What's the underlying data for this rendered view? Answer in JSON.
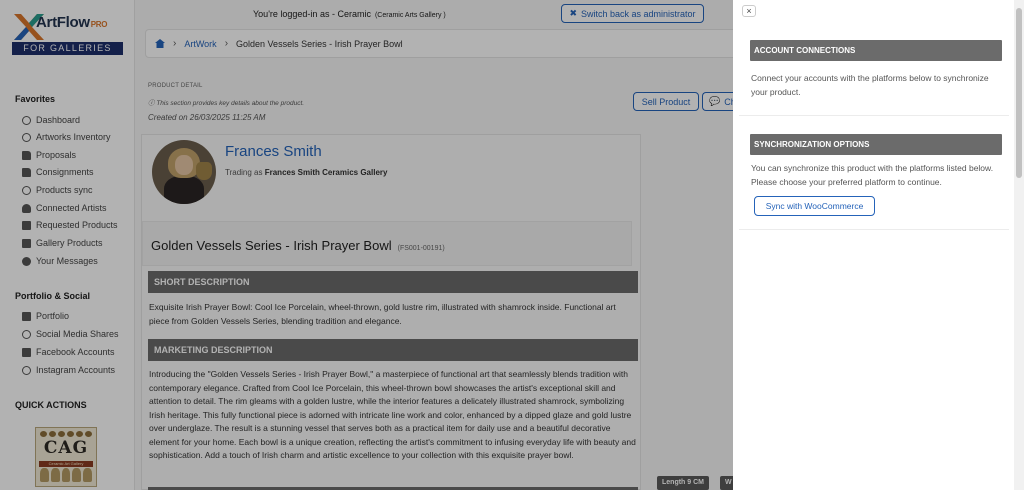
{
  "logo": {
    "brand": "ArtFlow",
    "pro": "PRO",
    "tagline": "FOR GALLERIES"
  },
  "sidebar": {
    "favorites_title": "Favorites",
    "favorites": [
      {
        "label": "Dashboard",
        "icon": "dashboard-icon"
      },
      {
        "label": "Artworks Inventory",
        "icon": "palette-icon"
      },
      {
        "label": "Proposals",
        "icon": "document-icon"
      },
      {
        "label": "Consignments",
        "icon": "file-icon"
      },
      {
        "label": "Products sync",
        "icon": "sync-icon"
      },
      {
        "label": "Connected Artists",
        "icon": "users-icon"
      },
      {
        "label": "Requested Products",
        "icon": "cart-icon"
      },
      {
        "label": "Gallery Products",
        "icon": "gallery-icon"
      },
      {
        "label": "Your Messages",
        "icon": "chat-icon"
      }
    ],
    "portfolio_title": "Portfolio & Social",
    "portfolio": [
      {
        "label": "Portfolio",
        "icon": "portfolio-icon"
      },
      {
        "label": "Social Media Shares",
        "icon": "share-icon"
      },
      {
        "label": "Facebook Accounts",
        "icon": "facebook-icon"
      },
      {
        "label": "Instagram Accounts",
        "icon": "instagram-icon"
      }
    ],
    "quick_title": "QUICK ACTIONS",
    "gallery_logo": {
      "letters": "CAG",
      "caption": "Ceramic Art Gallery"
    }
  },
  "topbar": {
    "logged_in": "You're logged-in as - Ceramic",
    "gallery": "(Ceramic Arts Gallery )",
    "switch_button": "Switch back as administrator"
  },
  "breadcrumb": {
    "link": "ArtWork",
    "current": "Golden Vessels Series - Irish Prayer Bowl"
  },
  "product": {
    "detail_label": "PRODUCT DETAIL",
    "detail_note": "This section provides key details about the product.",
    "created": "Created on 26/03/2025 11:25 AM",
    "sell_button": "Sell Product",
    "chat_button": "Ch",
    "artist_name": "Frances Smith",
    "trading_prefix": "Trading as",
    "trading_name": "Frances Smith Ceramics Gallery",
    "title": "Golden Vessels Series - Irish Prayer Bowl",
    "code": "(FS001-00191)",
    "short_heading": "SHORT DESCRIPTION",
    "short_text": "Exquisite Irish Prayer Bowl: Cool Ice Porcelain, wheel-thrown, gold lustre rim, illustrated with shamrock inside. Functional art piece from Golden Vessels Series, blending tradition and elegance.",
    "marketing_heading": "MARKETING DESCRIPTION",
    "marketing_text": "Introducing the \"Golden Vessels Series - Irish Prayer Bowl,\" a masterpiece of functional art that seamlessly blends tradition with contemporary elegance. Crafted from Cool Ice Porcelain, this wheel-thrown bowl showcases the artist's exceptional skill and attention to detail. The rim gleams with a golden lustre, while the interior features a delicately illustrated shamrock, symbolizing Irish heritage. This fully functional piece is adorned with intricate line work and color, enhanced by a dipped glaze and gold lustre over underglaze. The result is a stunning vessel that serves both as a practical item for daily use and a beautiful decorative element for your home. Each bowl is a unique creation, reflecting the artist's commitment to infusing everyday life with beauty and sophistication. Add a touch of Irish charm and artistic excellence to your collection with this exquisite prayer bowl.",
    "length_tag": "Length 9 CM",
    "width_tag": "W"
  },
  "panel": {
    "close": "×",
    "connections_heading": "ACCOUNT CONNECTIONS",
    "connections_text": "Connect your accounts with the platforms below to synchronize your product.",
    "sync_heading": "SYNCHRONIZATION OPTIONS",
    "sync_text": "You can synchronize this product with the platforms listed below. Please choose your preferred platform to continue.",
    "woo_button": "Sync with WooCommerce"
  },
  "colors": {
    "accent": "#2563b9",
    "section_header": "#6b6b6b",
    "brand_navy": "#1d2e6b"
  }
}
